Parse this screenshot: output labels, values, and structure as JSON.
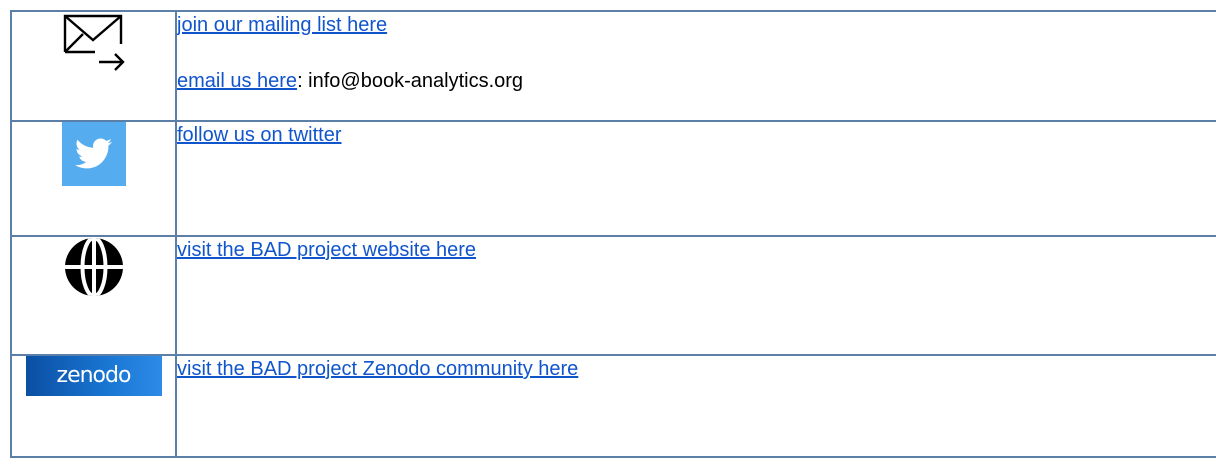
{
  "rows": [
    {
      "icon": "mail-forward-icon",
      "lines": [
        {
          "link_text": "join our mailing list here",
          "suffix": ""
        },
        {
          "link_text": "email us here",
          "suffix": ": info@book-analytics.org"
        }
      ]
    },
    {
      "icon": "twitter-bird-icon",
      "lines": [
        {
          "link_text": "follow us on twitter",
          "suffix": ""
        }
      ]
    },
    {
      "icon": "globe-icon",
      "lines": [
        {
          "link_text": "visit the BAD project website here",
          "suffix": ""
        }
      ]
    },
    {
      "icon": "zenodo-logo",
      "logo_text": "zenodo",
      "lines": [
        {
          "link_text": "visit the BAD project Zenodo community here",
          "suffix": ""
        }
      ]
    }
  ],
  "colors": {
    "border": "#5b7fa7",
    "link": "#1155cc",
    "twitter": "#55acee",
    "zenodo": "#1976d2"
  }
}
